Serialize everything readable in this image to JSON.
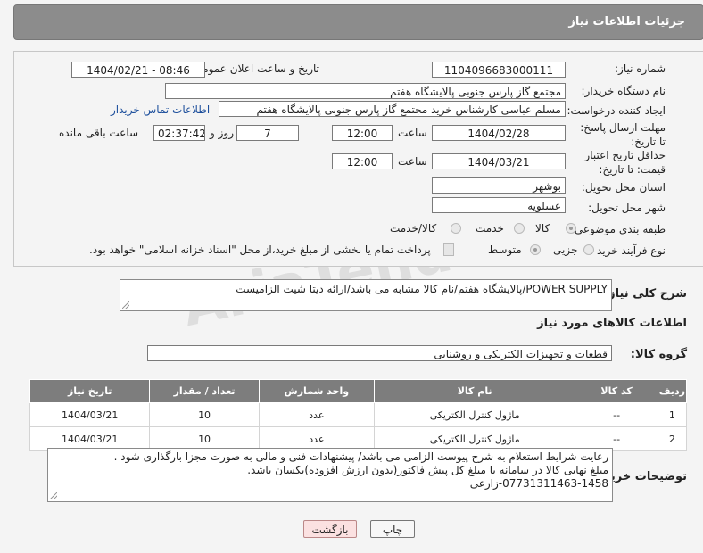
{
  "header": {
    "title": "جزئیات اطلاعات نیاز"
  },
  "need_number": {
    "label": "شماره نیاز:",
    "value": "1104096683000111"
  },
  "announce_datetime": {
    "label": "تاریخ و ساعت اعلان عمومی:",
    "value": "1404/02/21 - 08:46"
  },
  "buyer_org": {
    "label": "نام دستگاه خریدار:",
    "value": "مجتمع گاز پارس جنوبی  پالایشگاه هفتم"
  },
  "requester": {
    "label": "ایجاد کننده درخواست:",
    "value": "مسلم عباسی کارشناس خرید مجتمع گاز پارس جنوبی  پالایشگاه هفتم",
    "contact_link": "اطلاعات تماس خریدار"
  },
  "response_deadline": {
    "label": "مهلت ارسال پاسخ: تا تاریخ:",
    "date": "1404/02/28",
    "time_label": "ساعت",
    "time": "12:00",
    "days": "7",
    "days_label": "روز و",
    "remaining": "02:37:42",
    "remaining_label": "ساعت باقی مانده"
  },
  "price_validity": {
    "label": "حداقل تاریخ اعتبار قیمت: تا تاریخ:",
    "date": "1404/03/21",
    "time_label": "ساعت",
    "time": "12:00"
  },
  "delivery_province": {
    "label": "استان محل تحویل:",
    "value": "بوشهر"
  },
  "delivery_city": {
    "label": "شهر محل تحویل:",
    "value": "عسلویه"
  },
  "category": {
    "label": "طبقه بندی موضوعی:",
    "options": [
      "کالا",
      "خدمت",
      "کالا/خدمت"
    ],
    "selected": "کالا"
  },
  "purchase_process": {
    "label": "نوع فرآیند خرید :",
    "options": [
      "جزیی",
      "متوسط"
    ],
    "selected": "متوسط",
    "payment_note": "پرداخت تمام یا بخشی از مبلغ خرید،از محل \"اسناد خزانه اسلامی\" خواهد بود."
  },
  "description": {
    "label": "شرح کلی نیاز:",
    "value": "POWER SUPPLY/پالایشگاه هفتم/نام کالا مشابه می باشد/ارائه دیتا شیت الزامیست"
  },
  "goods_info": {
    "title": "اطلاعات کالاهای مورد نیاز"
  },
  "goods_group": {
    "label": "گروه کالا:",
    "value": "قطعات و تجهیزات الکتریکی و روشنایی"
  },
  "table": {
    "headers": [
      "ردیف",
      "کد کالا",
      "نام کالا",
      "واحد شمارش",
      "تعداد / مقدار",
      "تاریخ نیاز"
    ],
    "rows": [
      [
        "1",
        "--",
        "ماژول کنترل الکتریکی",
        "عدد",
        "10",
        "1404/03/21"
      ],
      [
        "2",
        "--",
        "ماژول کنترل الکتریکی",
        "عدد",
        "10",
        "1404/03/21"
      ]
    ]
  },
  "buyer_notes": {
    "label": "توضیحات خریدار:",
    "lines": [
      "رعایت شرایط استعلام به شرح پیوست الزامی می باشد/ پیشنهادات فنی و مالی به صورت مجزا بارگذاری شود .",
      "مبلغ نهایی کالا در سامانه با مبلغ کل پیش فاکتور(بدون ارزش افزوده)یکسان باشد.",
      "07731311463-1458-زارعی"
    ]
  },
  "buttons": {
    "print": "چاپ",
    "back": "بازگشت"
  },
  "watermark": {
    "text": "AriaTender.net"
  }
}
